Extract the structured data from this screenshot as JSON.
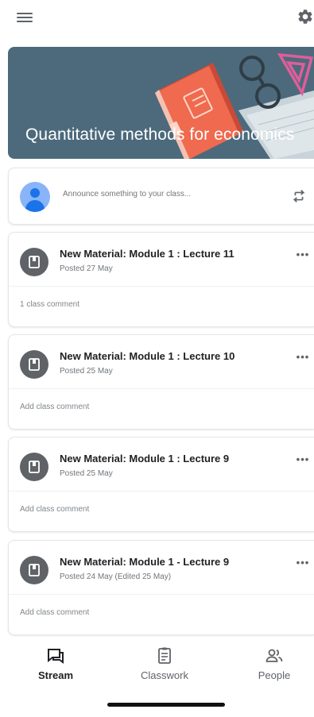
{
  "banner": {
    "title": "Quantitative methods for economics"
  },
  "announce": {
    "placeholder": "Announce something to your class..."
  },
  "posts": [
    {
      "title": "New Material: Module 1 : Lecture 11",
      "date": "Posted 27 May",
      "comment": "1 class comment"
    },
    {
      "title": "New Material: Module 1 : Lecture 10",
      "date": "Posted 25 May",
      "comment": "Add class comment"
    },
    {
      "title": "New Material: Module 1 : Lecture 9",
      "date": "Posted 25 May",
      "comment": "Add class comment"
    },
    {
      "title": "New Material: Module 1 - Lecture 9",
      "date": "Posted 24 May (Edited 25 May)",
      "comment": "Add class comment"
    }
  ],
  "more_label": "•••",
  "nav": {
    "active": "stream",
    "tabs": [
      {
        "label": "Stream",
        "icon": "stream-icon"
      },
      {
        "label": "Classwork",
        "icon": "classwork-icon"
      },
      {
        "label": "People",
        "icon": "people-icon"
      }
    ]
  },
  "icons": {
    "menu": "menu-icon",
    "settings": "gear-icon",
    "repost": "repost-icon",
    "material": "material-icon",
    "more": "more-vert-icon"
  },
  "colors": {
    "banner": "#4c6a7c",
    "accent": "#1a73e8",
    "book": "#e8624a",
    "icon_grey": "#5f6368"
  }
}
